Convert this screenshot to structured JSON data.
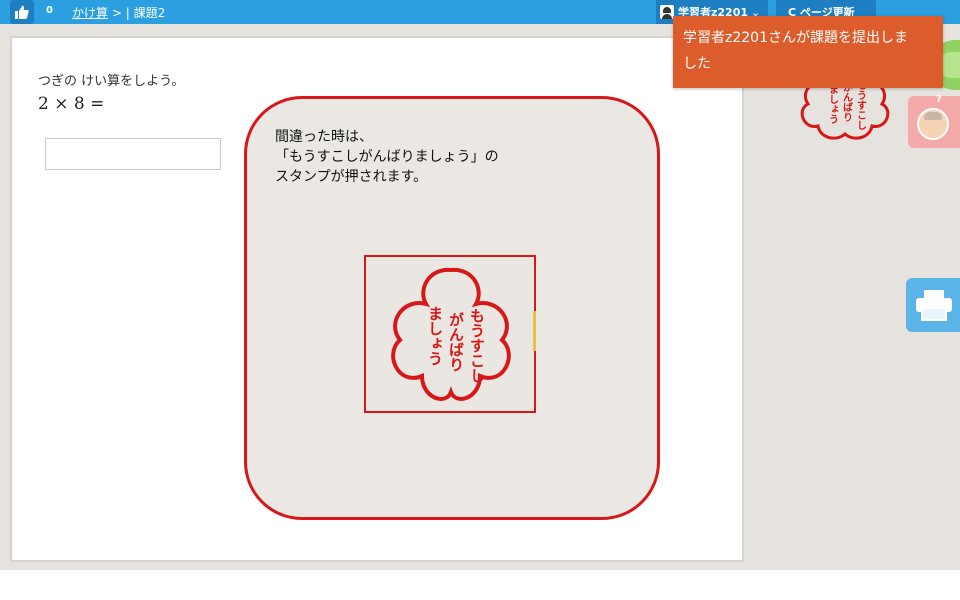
{
  "topbar": {
    "like_count": "0",
    "breadcrumb_link": "かけ算",
    "breadcrumb_separator": " > | ",
    "breadcrumb_current": "課題2",
    "user_name": "学習者z2201",
    "user_caret": "⌄",
    "refresh_label": "C ページ更新"
  },
  "problem": {
    "prompt": "つぎの けい算をしよう。",
    "equation": "2 × 8 ="
  },
  "answer": {
    "value": ""
  },
  "toast": {
    "line1": "学習者z2201さんが課題を提出しま",
    "line2": "した"
  },
  "callout": {
    "line1": "間違った時は、",
    "line2": "「もうすこしがんばりましょう」の",
    "line3": "スタンプが押されます。"
  },
  "stamp": {
    "col1": "もうすこし",
    "col2": "がんばり",
    "col3": "ましょう"
  },
  "side": {
    "help_mark": "?"
  },
  "colors": {
    "topbar": "#2b9fe0",
    "toast": "#dd5c2c",
    "callout_border": "#d81818",
    "stamp_red": "#d81818"
  }
}
